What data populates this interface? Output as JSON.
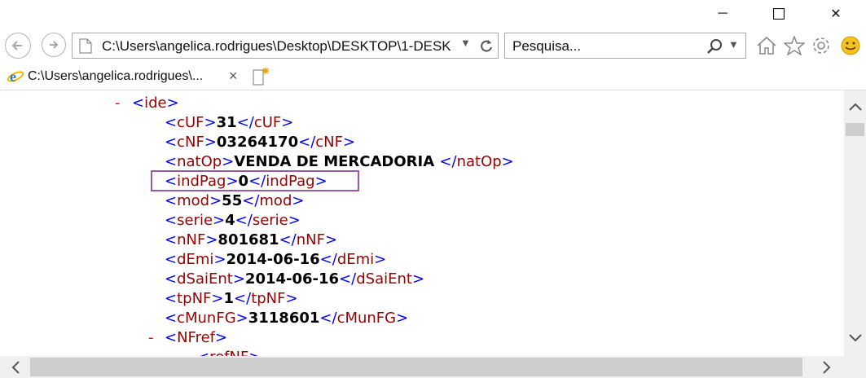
{
  "window": {
    "minimize_glyph": "─",
    "maximize_glyph": "☐",
    "close_glyph": "✕"
  },
  "address": {
    "url": "C:\\Users\\angelica.rodrigues\\Desktop\\DESKTOP\\1-DESK"
  },
  "search": {
    "placeholder": "Pesquisa..."
  },
  "tab": {
    "title": "C:\\Users\\angelica.rodrigues\\...",
    "close": "×"
  },
  "icons": {
    "back": "back-arrow-icon",
    "forward": "forward-arrow-icon",
    "page": "page-icon",
    "refresh": "refresh-icon",
    "search": "search-icon",
    "home": "home-icon",
    "favorites": "star-icon",
    "tools": "gear-icon",
    "feedback": "smiley-icon",
    "ie": "ie-logo-icon",
    "new_tab": "new-tab-icon"
  },
  "xml": {
    "ide_tag": "ide",
    "fields": [
      {
        "tag": "cUF",
        "value": "31"
      },
      {
        "tag": "cNF",
        "value": "03264170"
      },
      {
        "tag": "natOp",
        "value": "VENDA DE MERCADORIA "
      },
      {
        "tag": "indPag",
        "value": "0"
      },
      {
        "tag": "mod",
        "value": "55"
      },
      {
        "tag": "serie",
        "value": "4"
      },
      {
        "tag": "nNF",
        "value": "801681"
      },
      {
        "tag": "dEmi",
        "value": "2014-06-16"
      },
      {
        "tag": "dSaiEnt",
        "value": "2014-06-16"
      },
      {
        "tag": "tpNF",
        "value": "1"
      },
      {
        "tag": "cMunFG",
        "value": "3118601"
      }
    ],
    "nfref_tag": "NFref",
    "partial_tag": "refNF"
  },
  "colors": {
    "bracket": "#0000ff",
    "tag_name": "#990000",
    "collapse": "#ff0000",
    "highlight": "#9a58a8"
  }
}
